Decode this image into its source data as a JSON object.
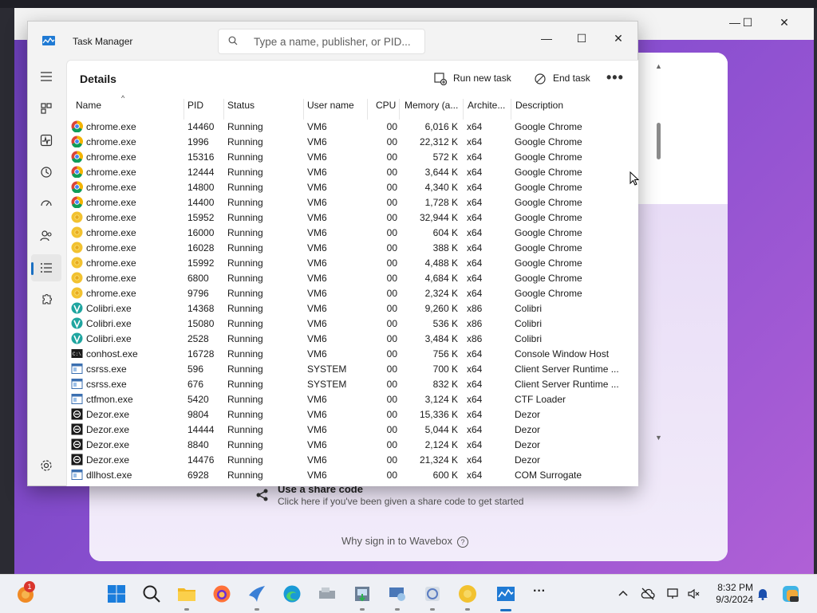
{
  "taskmanager": {
    "title": "Task Manager",
    "search_placeholder": "Type a name, publisher, or PID...",
    "page_title": "Details",
    "run_new_task": "Run new task",
    "end_task": "End task",
    "more": "•••",
    "columns": [
      "Name",
      "PID",
      "Status",
      "User name",
      "CPU",
      "Memory (a...",
      "Archite...",
      "Description"
    ],
    "rows": [
      {
        "name": "chrome.exe",
        "pid": "14460",
        "status": "Running",
        "user": "VM6",
        "cpu": "00",
        "mem": "6,016 K",
        "arch": "x64",
        "desc": "Google Chrome",
        "icon": "chrome-red"
      },
      {
        "name": "chrome.exe",
        "pid": "1996",
        "status": "Running",
        "user": "VM6",
        "cpu": "00",
        "mem": "22,312 K",
        "arch": "x64",
        "desc": "Google Chrome",
        "icon": "chrome-red"
      },
      {
        "name": "chrome.exe",
        "pid": "15316",
        "status": "Running",
        "user": "VM6",
        "cpu": "00",
        "mem": "572 K",
        "arch": "x64",
        "desc": "Google Chrome",
        "icon": "chrome-red"
      },
      {
        "name": "chrome.exe",
        "pid": "12444",
        "status": "Running",
        "user": "VM6",
        "cpu": "00",
        "mem": "3,644 K",
        "arch": "x64",
        "desc": "Google Chrome",
        "icon": "chrome-red"
      },
      {
        "name": "chrome.exe",
        "pid": "14800",
        "status": "Running",
        "user": "VM6",
        "cpu": "00",
        "mem": "4,340 K",
        "arch": "x64",
        "desc": "Google Chrome",
        "icon": "chrome-red"
      },
      {
        "name": "chrome.exe",
        "pid": "14400",
        "status": "Running",
        "user": "VM6",
        "cpu": "00",
        "mem": "1,728 K",
        "arch": "x64",
        "desc": "Google Chrome",
        "icon": "chrome-red"
      },
      {
        "name": "chrome.exe",
        "pid": "15952",
        "status": "Running",
        "user": "VM6",
        "cpu": "00",
        "mem": "32,944 K",
        "arch": "x64",
        "desc": "Google Chrome",
        "icon": "chrome-yellow"
      },
      {
        "name": "chrome.exe",
        "pid": "16000",
        "status": "Running",
        "user": "VM6",
        "cpu": "00",
        "mem": "604 K",
        "arch": "x64",
        "desc": "Google Chrome",
        "icon": "chrome-yellow"
      },
      {
        "name": "chrome.exe",
        "pid": "16028",
        "status": "Running",
        "user": "VM6",
        "cpu": "00",
        "mem": "388 K",
        "arch": "x64",
        "desc": "Google Chrome",
        "icon": "chrome-yellow"
      },
      {
        "name": "chrome.exe",
        "pid": "15992",
        "status": "Running",
        "user": "VM6",
        "cpu": "00",
        "mem": "4,488 K",
        "arch": "x64",
        "desc": "Google Chrome",
        "icon": "chrome-yellow"
      },
      {
        "name": "chrome.exe",
        "pid": "6800",
        "status": "Running",
        "user": "VM6",
        "cpu": "00",
        "mem": "4,684 K",
        "arch": "x64",
        "desc": "Google Chrome",
        "icon": "chrome-yellow"
      },
      {
        "name": "chrome.exe",
        "pid": "9796",
        "status": "Running",
        "user": "VM6",
        "cpu": "00",
        "mem": "2,324 K",
        "arch": "x64",
        "desc": "Google Chrome",
        "icon": "chrome-yellow"
      },
      {
        "name": "Colibri.exe",
        "pid": "14368",
        "status": "Running",
        "user": "VM6",
        "cpu": "00",
        "mem": "9,260 K",
        "arch": "x86",
        "desc": "Colibri",
        "icon": "colibri"
      },
      {
        "name": "Colibri.exe",
        "pid": "15080",
        "status": "Running",
        "user": "VM6",
        "cpu": "00",
        "mem": "536 K",
        "arch": "x86",
        "desc": "Colibri",
        "icon": "colibri"
      },
      {
        "name": "Colibri.exe",
        "pid": "2528",
        "status": "Running",
        "user": "VM6",
        "cpu": "00",
        "mem": "3,484 K",
        "arch": "x86",
        "desc": "Colibri",
        "icon": "colibri"
      },
      {
        "name": "conhost.exe",
        "pid": "16728",
        "status": "Running",
        "user": "VM6",
        "cpu": "00",
        "mem": "756 K",
        "arch": "x64",
        "desc": "Console Window Host",
        "icon": "console"
      },
      {
        "name": "csrss.exe",
        "pid": "596",
        "status": "Running",
        "user": "SYSTEM",
        "cpu": "00",
        "mem": "700 K",
        "arch": "x64",
        "desc": "Client Server Runtime ...",
        "icon": "system"
      },
      {
        "name": "csrss.exe",
        "pid": "676",
        "status": "Running",
        "user": "SYSTEM",
        "cpu": "00",
        "mem": "832 K",
        "arch": "x64",
        "desc": "Client Server Runtime ...",
        "icon": "system"
      },
      {
        "name": "ctfmon.exe",
        "pid": "5420",
        "status": "Running",
        "user": "VM6",
        "cpu": "00",
        "mem": "3,124 K",
        "arch": "x64",
        "desc": "CTF Loader",
        "icon": "system"
      },
      {
        "name": "Dezor.exe",
        "pid": "9804",
        "status": "Running",
        "user": "VM6",
        "cpu": "00",
        "mem": "15,336 K",
        "arch": "x64",
        "desc": "Dezor",
        "icon": "dezor"
      },
      {
        "name": "Dezor.exe",
        "pid": "14444",
        "status": "Running",
        "user": "VM6",
        "cpu": "00",
        "mem": "5,044 K",
        "arch": "x64",
        "desc": "Dezor",
        "icon": "dezor"
      },
      {
        "name": "Dezor.exe",
        "pid": "8840",
        "status": "Running",
        "user": "VM6",
        "cpu": "00",
        "mem": "2,124 K",
        "arch": "x64",
        "desc": "Dezor",
        "icon": "dezor"
      },
      {
        "name": "Dezor.exe",
        "pid": "14476",
        "status": "Running",
        "user": "VM6",
        "cpu": "00",
        "mem": "21,324 K",
        "arch": "x64",
        "desc": "Dezor",
        "icon": "dezor"
      },
      {
        "name": "dllhost.exe",
        "pid": "6928",
        "status": "Running",
        "user": "VM6",
        "cpu": "00",
        "mem": "600 K",
        "arch": "x64",
        "desc": "COM Surrogate",
        "icon": "system"
      }
    ]
  },
  "wavebox": {
    "share_title": "Use a share code",
    "share_sub": "Click here if you've been given a share code to get started",
    "why_sign_in": "Why sign in to Wavebox",
    "why_icon": "?"
  },
  "taskbar": {
    "notification_count": "1",
    "time": "8:32 PM",
    "date": "9/3/2024"
  },
  "colors": {
    "accent": "#1a6fc2",
    "purple": "#8a4fd0",
    "chrome_yellow": "#f2c230",
    "chrome_red": "#db4437",
    "colibri": "#1fa5a0"
  }
}
